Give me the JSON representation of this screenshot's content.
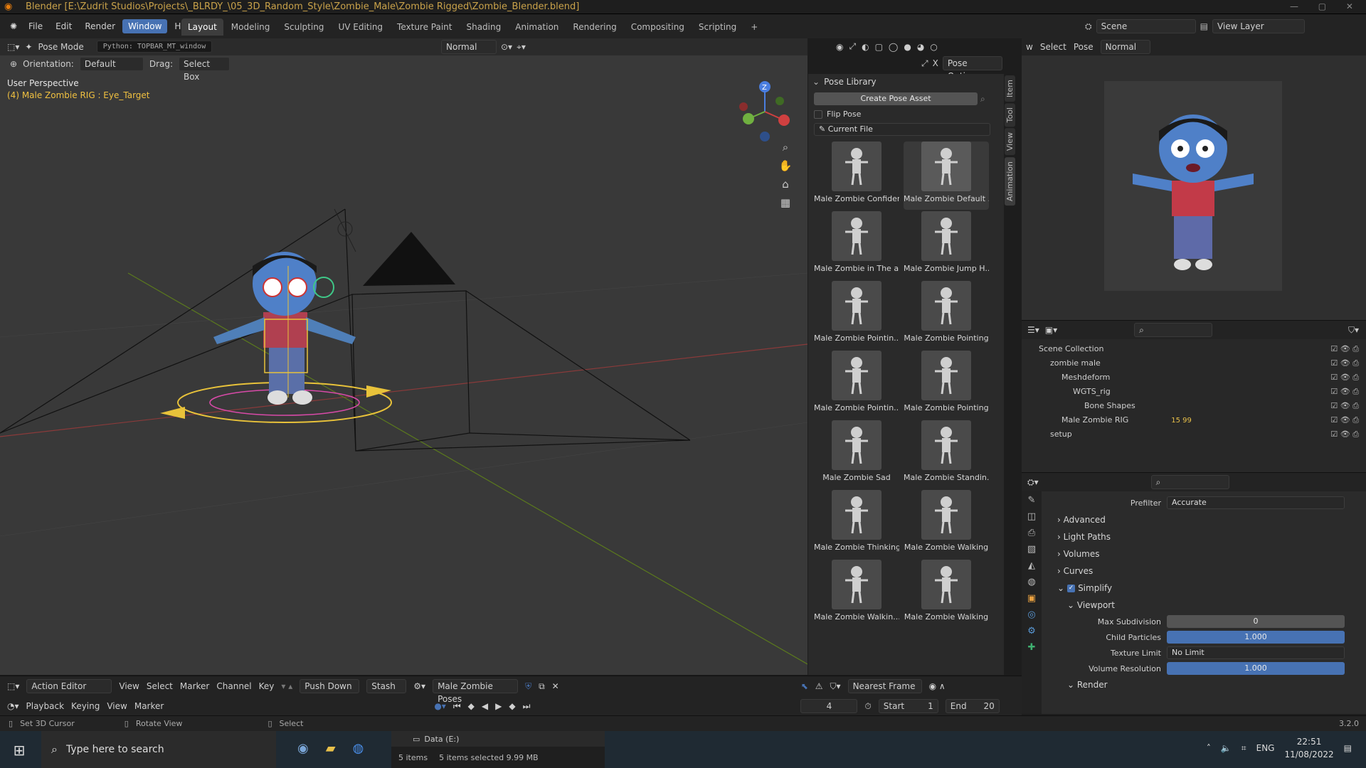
{
  "title_bar": {
    "text": "Blender [E:\\Zudrit Studios\\Projects\\_BLRDY_\\05_3D_Random_Style\\Zombie_Male\\Zombie Rigged\\Zombie_Blender.blend]"
  },
  "menus": [
    "File",
    "Edit",
    "Render",
    "Window",
    "Help"
  ],
  "active_menu": "Window",
  "workspaces": [
    "Layout",
    "Modeling",
    "Sculpting",
    "UV Editing",
    "Texture Paint",
    "Shading",
    "Animation",
    "Rendering",
    "Compositing",
    "Scripting"
  ],
  "active_workspace": "Layout",
  "scene": {
    "name": "Scene",
    "view_layer": "View Layer"
  },
  "viewport": {
    "mode": "Pose Mode",
    "tooltip": "Python: TOPBAR_MT_window",
    "orientation_label": "Orientation:",
    "orientation": "Default",
    "drag_label": "Drag:",
    "drag_value": "Select Box",
    "pivot": "Normal",
    "perspective": "User Perspective",
    "active_object": "(4) Male Zombie RIG : Eye_Target",
    "pose_options": "Pose Options",
    "gizmo": {
      "z": "Z"
    }
  },
  "pose_library": {
    "title": "Pose Library",
    "create_button": "Create Pose Asset",
    "flip_label": "Flip Pose",
    "source": "Current File",
    "poses": [
      "Male Zombie Confiden",
      "Male Zombie Default ...",
      "Male Zombie in The ai",
      "Male Zombie Jump H...",
      "Male Zombie Pointin...",
      "Male Zombie Pointing",
      "Male Zombie Pointin...",
      "Male Zombie Pointing",
      "Male Zombie Sad",
      "Male Zombie Standin...",
      "Male Zombie Thinking",
      "Male Zombie Walking",
      "Male Zombie Walkin...",
      "Male Zombie Walking"
    ],
    "selected_index": 1
  },
  "side_tabs": [
    "Item",
    "Tool",
    "View",
    "Animation"
  ],
  "right_header": {
    "w": "w",
    "select": "Select",
    "pose": "Pose",
    "pivot": "Normal"
  },
  "outliner": {
    "rows": [
      {
        "label": "Scene Collection",
        "indent": 0
      },
      {
        "label": "zombie male",
        "indent": 1
      },
      {
        "label": "Meshdeform",
        "indent": 2
      },
      {
        "label": "WGTS_rig",
        "indent": 3
      },
      {
        "label": "Bone Shapes",
        "indent": 4
      },
      {
        "label": "Male Zombie RIG",
        "indent": 2
      },
      {
        "label": "setup",
        "indent": 1
      }
    ],
    "rig_badges": {
      "a": "15",
      "b": "99"
    }
  },
  "properties": {
    "prefilter_label": "Prefilter",
    "prefilter": "Accurate",
    "sections": [
      "Advanced",
      "Light Paths",
      "Volumes",
      "Curves"
    ],
    "simplify": "Simplify",
    "viewport": "Viewport",
    "fields": [
      {
        "label": "Max Subdivision",
        "value": "0",
        "style": "gray"
      },
      {
        "label": "Child Particles",
        "value": "1.000",
        "style": "blue"
      },
      {
        "label": "Texture Limit",
        "value": "No Limit",
        "style": "drop"
      },
      {
        "label": "Volume Resolution",
        "value": "1.000",
        "style": "blue"
      }
    ],
    "render": "Render"
  },
  "action_editor": {
    "editor": "Action Editor",
    "menus": [
      "View",
      "Select",
      "Marker",
      "Channel",
      "Key"
    ],
    "push_down": "Push Down",
    "stash": "Stash",
    "action": "Male Zombie Poses",
    "snap": "Nearest Frame"
  },
  "timeline": {
    "menus": [
      "Playback",
      "Keying",
      "View",
      "Marker"
    ],
    "current_frame": "4",
    "start_label": "Start",
    "start": "1",
    "end_label": "End",
    "end": "20"
  },
  "status": {
    "left": "Set 3D Cursor",
    "mid": "Rotate View",
    "right": "Select",
    "version": "3.2.0",
    "drive": "Data (E:)",
    "items": "5 items",
    "selected": "5 items selected  9.99 MB"
  },
  "taskbar": {
    "search": "Type here to search",
    "lang": "ENG",
    "time": "22:51",
    "date": "11/08/2022"
  },
  "colors": {
    "accent": "#4772b3",
    "title": "#c9a24a",
    "active_text": "#f0c040"
  }
}
